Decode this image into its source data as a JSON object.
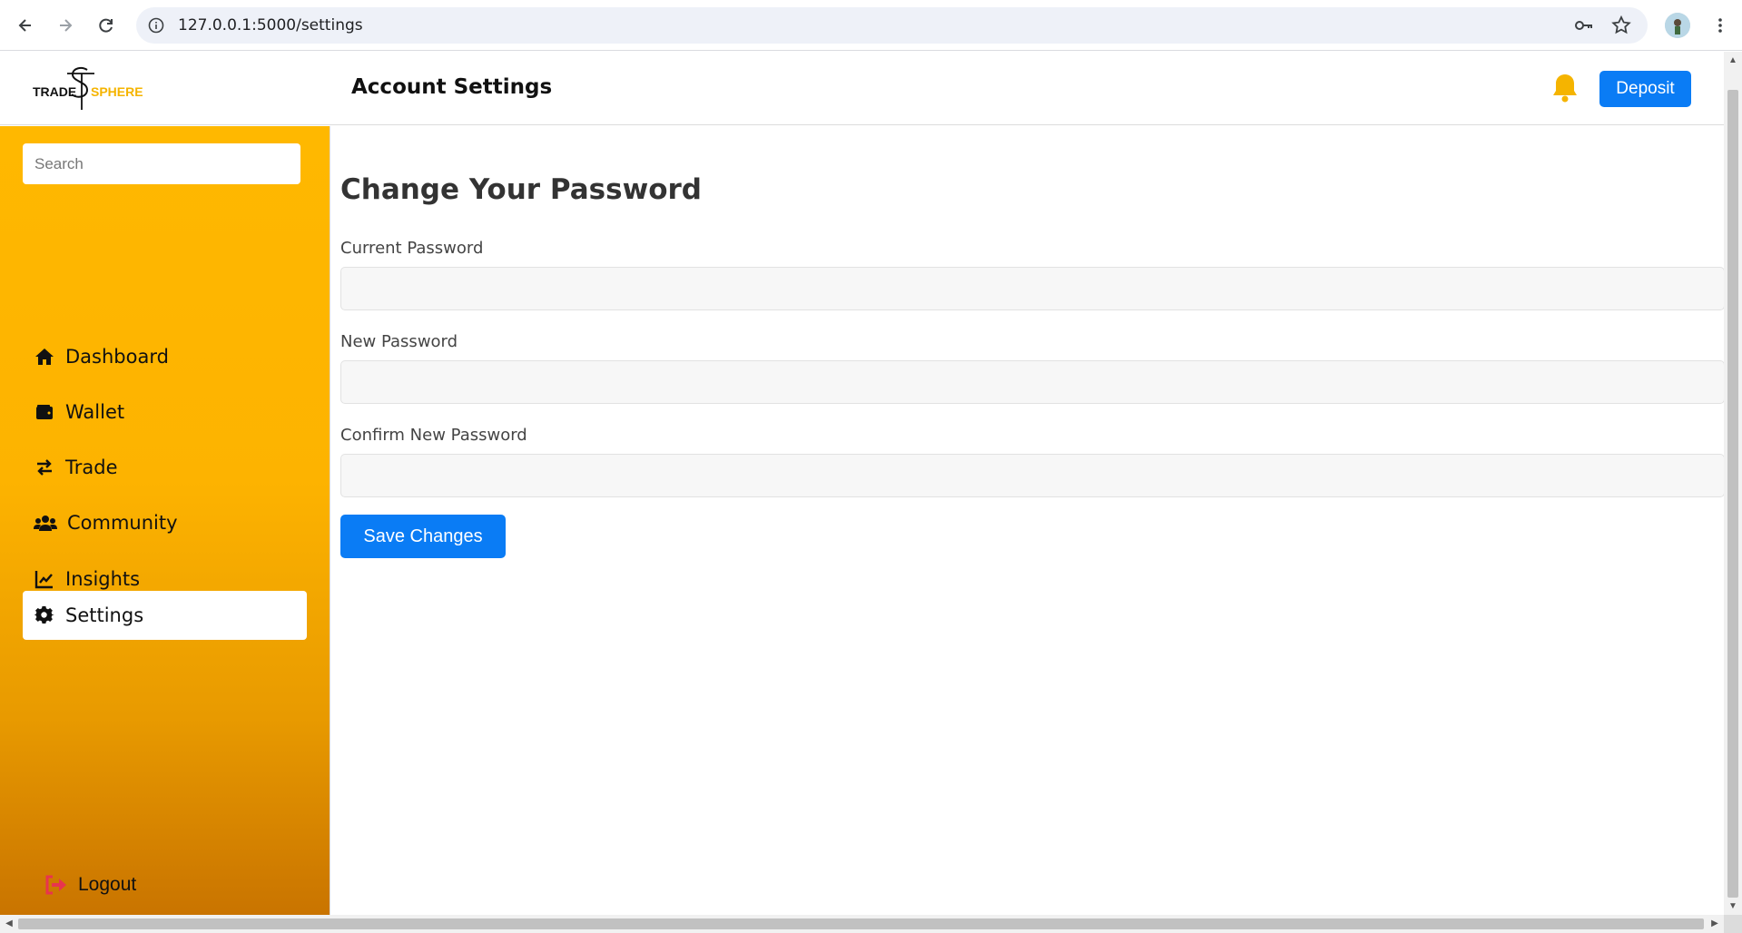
{
  "browser": {
    "url": "127.0.0.1:5000/settings"
  },
  "header": {
    "logo_left": "TRADE",
    "logo_right": "SPHERE",
    "title": "Account Settings",
    "deposit_label": "Deposit"
  },
  "sidebar": {
    "search_placeholder": "Search",
    "items": [
      {
        "label": "Dashboard",
        "icon": "home-icon"
      },
      {
        "label": "Wallet",
        "icon": "wallet-icon"
      },
      {
        "label": "Trade",
        "icon": "exchange-icon"
      },
      {
        "label": "Community",
        "icon": "users-icon"
      },
      {
        "label": "Insights",
        "icon": "chart-line-icon"
      },
      {
        "label": "Settings",
        "icon": "gear-icon",
        "active": true
      }
    ],
    "logout_label": "Logout"
  },
  "main": {
    "form_title": "Change Your Password",
    "fields": [
      {
        "label": "Current Password",
        "value": ""
      },
      {
        "label": "New Password",
        "value": ""
      },
      {
        "label": "Confirm New Password",
        "value": ""
      }
    ],
    "save_label": "Save Changes"
  },
  "colors": {
    "accent": "#0a7cf5",
    "sidebar_top": "#ffb800",
    "sidebar_bottom": "#c97400",
    "bell": "#f5b400",
    "logout_icon": "#e8344e"
  }
}
